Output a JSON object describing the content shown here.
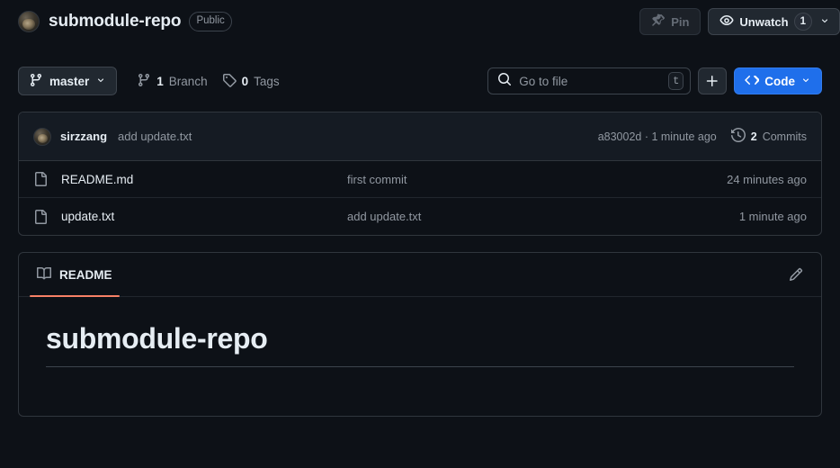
{
  "repo": {
    "owner_avatar": "owner-avatar",
    "name": "submodule-repo",
    "visibility": "Public"
  },
  "header_actions": {
    "pin_label": "Pin",
    "watch_label": "Unwatch",
    "watch_count": "1"
  },
  "toolbar": {
    "branch_name": "master",
    "branch_count": "1",
    "branch_word": "Branch",
    "tag_count": "0",
    "tag_word": "Tags",
    "search_placeholder": "Go to file",
    "search_value": "",
    "search_shortcut": "t",
    "add_label": "+",
    "code_label": "Code"
  },
  "commit_bar": {
    "author": "sirzzang",
    "message": "add update.txt",
    "sha_and_time": "a83002d · 1 minute ago",
    "commits_count": "2",
    "commits_word": "Commits"
  },
  "files": [
    {
      "name": "README.md",
      "commit_message": "first commit",
      "time": "24 minutes ago"
    },
    {
      "name": "update.txt",
      "commit_message": "add update.txt",
      "time": "1 minute ago"
    }
  ],
  "readme": {
    "tab_label": "README",
    "heading": "submodule-repo"
  },
  "colors": {
    "page_bg": "#0d1117",
    "panel_bg": "#151b23",
    "border": "#30363d",
    "accent_blue": "#1f6feb",
    "tab_underline": "#f78166",
    "muted_text": "#9198a1"
  }
}
